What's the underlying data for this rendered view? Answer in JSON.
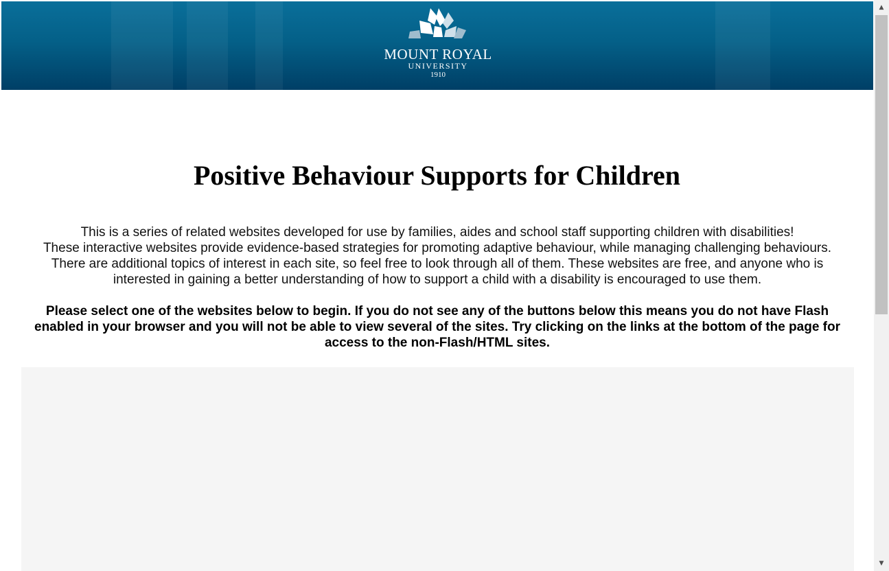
{
  "banner": {
    "logo": {
      "name": "MOUNT ROYAL",
      "sub": "UNIVERSITY",
      "year": "1910",
      "icon": "mru-logo-icon"
    },
    "colors": {
      "top": "#0a6f9a",
      "bottom": "#003f66"
    }
  },
  "page": {
    "title": "Positive Behaviour Supports for Children",
    "intro": [
      "This is a series of related websites developed for use by families, aides and school staff supporting children with disabilities!",
      "These interactive websites provide evidence-based strategies for promoting adaptive behaviour, while managing challenging behaviours.",
      "There are additional topics of interest in each site, so feel free to look through all of them. These websites are free, and anyone who is",
      "interested in gaining a better understanding of how to support a child with a disability is encouraged to use them."
    ],
    "instructions": "Please select one of the websites below to begin. If you do not see any of the buttons below this means you do not have Flash enabled in your browser and you will not be able to view several of the sites. Try clicking on the links at the bottom of the page for access to the non-Flash/HTML sites."
  },
  "scrollbar": {
    "up_icon": "scroll-up-arrow-icon",
    "down_icon": "scroll-down-arrow-icon",
    "up_glyph": "▲",
    "down_glyph": "▼"
  }
}
